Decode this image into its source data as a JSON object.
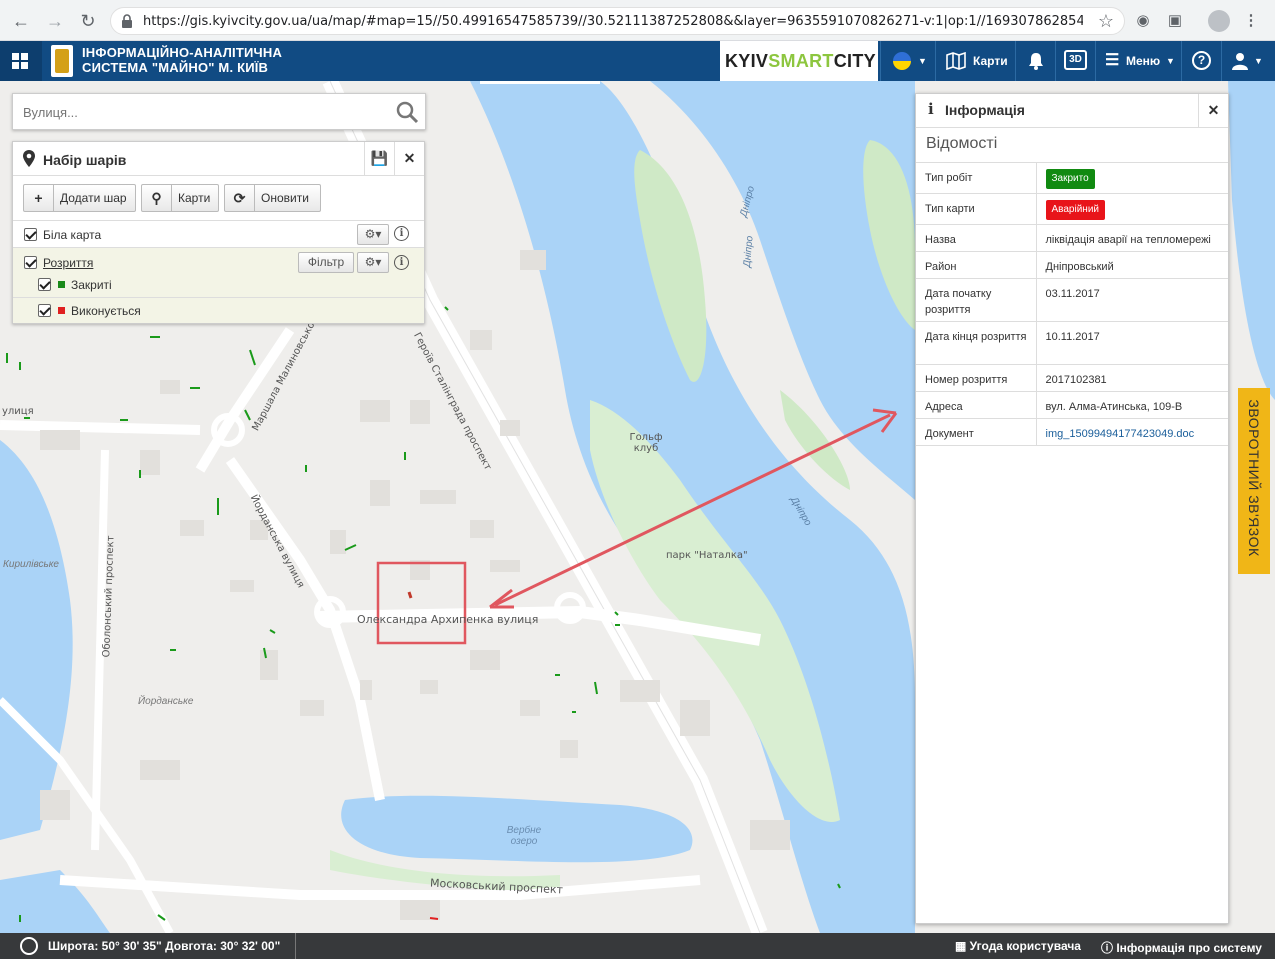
{
  "browser": {
    "url": "https://gis.kyivcity.gov.ua/ua/map/#map=15//50.49916547585739//30.52111387252808&&layer=9635591070826271-v:1|op:1//169307862854952891..."
  },
  "header": {
    "title_line1": "ІНФОРМАЦІЙНО-АНАЛІТИЧНА",
    "title_line2": "СИСТЕМА \"МАЙНО\" М. КИЇВ",
    "brand_kyiv": "KYIV",
    "brand_smart": "SMART",
    "brand_city": "CITY",
    "maps_label": "Карти",
    "threeD_label": "3D",
    "menu_label": "Меню"
  },
  "search": {
    "placeholder": "Вулиця..."
  },
  "layers_panel": {
    "title": "Набір шарів",
    "add_layer": "Додати шар",
    "maps": "Карти",
    "refresh": "Оновити",
    "layer_base": "Біла карта",
    "layer_digs": "Розриття",
    "filter": "Фільтр",
    "sub_closed": "Закриті",
    "sub_running": "Виконується",
    "colors": {
      "closed": "#1a8a1a",
      "running": "#e02020"
    }
  },
  "info_panel": {
    "title": "Інформація",
    "subtitle": "Відомості",
    "rows": [
      {
        "key": "Тип робіт",
        "value": "Закрито"
      },
      {
        "key": "Тип карти",
        "value": "Аварійний"
      },
      {
        "key": "Назва",
        "value": "ліквідація аварії на тепломережі"
      },
      {
        "key": "Район",
        "value": "Дніпровський"
      },
      {
        "key": "Дата початку розриття",
        "value": "03.11.2017"
      },
      {
        "key": "Дата кінця розриття",
        "value": "10.11.2017"
      },
      {
        "key": "Номер розриття",
        "value": "2017102381"
      },
      {
        "key": "Адреса",
        "value": "вул. Алма-Атинська, 109-В"
      },
      {
        "key": "Документ",
        "value": "img_15099494177423049.doc"
      }
    ],
    "badge_colors": {
      "closed": "#118a11",
      "emergency": "#e8141a"
    }
  },
  "feedback": "ЗВОРОТНИЙ ЗВ'ЯЗОК",
  "map_labels": {
    "golf": "Гольф клуб",
    "park": "парк \"Наталка\"",
    "dnipro1": "Дніпро",
    "dnipro2": "Дніпро",
    "dnipro3": "Дніпро",
    "archypenka": "Олександра Архипенка вулиця",
    "yordanska_st": "Йорданська вулиця",
    "yordanske": "Йорданське",
    "obolonskyi": "Оболонський проспект",
    "kyrylivske": "Кирилівське",
    "verbne": "Вербне озеро",
    "moskovskyi": "Московський проспект",
    "stalingrad": "Героїв Сталінграда проспект",
    "malynovskoho": "Маршала Малиновського",
    "ulytsia": "улиця"
  },
  "footer": {
    "coords": "Широта: 50° 30' 35\" Довгота: 30° 32' 00\"",
    "agreement": "Угода користувача",
    "sysinfo": "Інформація про систему"
  }
}
